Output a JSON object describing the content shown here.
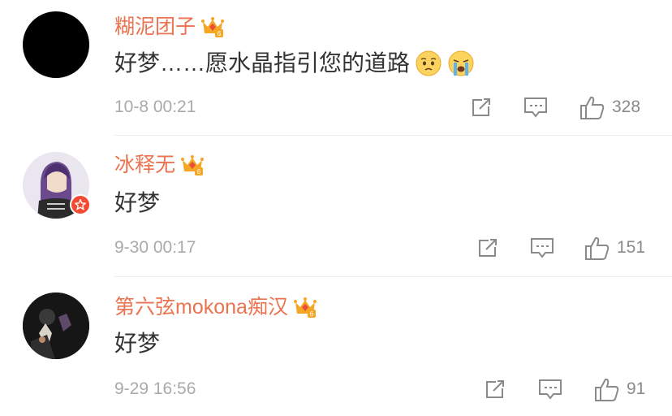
{
  "comments": [
    {
      "username": "糊泥团子",
      "text": "好梦……愿水晶指引您的道路",
      "emojis": [
        "pleading-face-icon",
        "crying-face-icon"
      ],
      "time": "10-8 00:21",
      "likes": "328"
    },
    {
      "username": "冰释无",
      "text": "好梦",
      "time": "9-30 00:17",
      "likes": "151"
    },
    {
      "username": "第六弦mokona痴汉",
      "text": "好梦",
      "time": "9-29 16:56",
      "likes": "91"
    }
  ],
  "colors": {
    "username": "#eb7350",
    "text": "#333333",
    "meta": "#aaaaaa",
    "crown": "#f5a623",
    "vip_badge": "#f24b32"
  },
  "icons": {
    "vip": "crown-icon",
    "repost": "repost-icon",
    "comment": "comment-icon",
    "like": "thumbs-up-icon"
  }
}
